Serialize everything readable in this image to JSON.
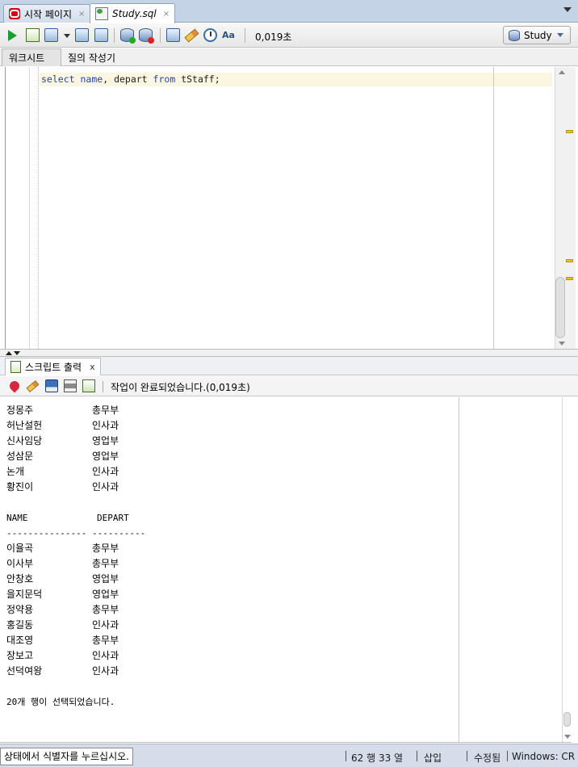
{
  "tabs": [
    {
      "label": "시작 페이지",
      "close": "×"
    },
    {
      "label": "Study.sql",
      "close": "×"
    }
  ],
  "toolbar": {
    "elapsed": "0,019초",
    "connection": "Study"
  },
  "subtabs": [
    {
      "label": "워크시트"
    },
    {
      "label": "질의 작성기"
    }
  ],
  "editor": {
    "kw_select": "select",
    "id_name": "name",
    "comma": ",",
    "id_depart": "depart",
    "kw_from": "from",
    "id_table": "tStaff",
    "semicolon": ";"
  },
  "output": {
    "tab_label": "스크립트 출력",
    "tab_close": "x",
    "status": "작업이 완료되었습니다.(0,019초)",
    "rows_top": [
      {
        "name": "정몽주",
        "depart": "총무부"
      },
      {
        "name": "허난설헌",
        "depart": "인사과"
      },
      {
        "name": "신사임당",
        "depart": "영업부"
      },
      {
        "name": "성삼문",
        "depart": "영업부"
      },
      {
        "name": "논개",
        "depart": "인사과"
      },
      {
        "name": "황진이",
        "depart": "인사과"
      }
    ],
    "header_name": "NAME",
    "header_depart": "DEPART",
    "divider": "--------------- ----------",
    "rows_bottom": [
      {
        "name": "이율곡",
        "depart": "총무부"
      },
      {
        "name": "이사부",
        "depart": "총무부"
      },
      {
        "name": "안창호",
        "depart": "영업부"
      },
      {
        "name": "을지문덕",
        "depart": "영업부"
      },
      {
        "name": "정약용",
        "depart": "총무부"
      },
      {
        "name": "홍길동",
        "depart": "인사과"
      },
      {
        "name": "대조영",
        "depart": "총무부"
      },
      {
        "name": "장보고",
        "depart": "인사과"
      },
      {
        "name": "선덕여왕",
        "depart": "인사과"
      }
    ],
    "summary": "20개 행이 선택되었습니다."
  },
  "statusbar": {
    "hint": "상태에서 식별자를 누르십시오.",
    "position": "62 행 33 열",
    "mode": "삽입",
    "modified": "수정됨",
    "eol": "Windows: CR"
  },
  "colors": {
    "keyword": "#2c3fb5",
    "current_line": "#fbf6e0",
    "tab_bar": "#c5d3e6",
    "status_bar": "#d4dde9"
  }
}
